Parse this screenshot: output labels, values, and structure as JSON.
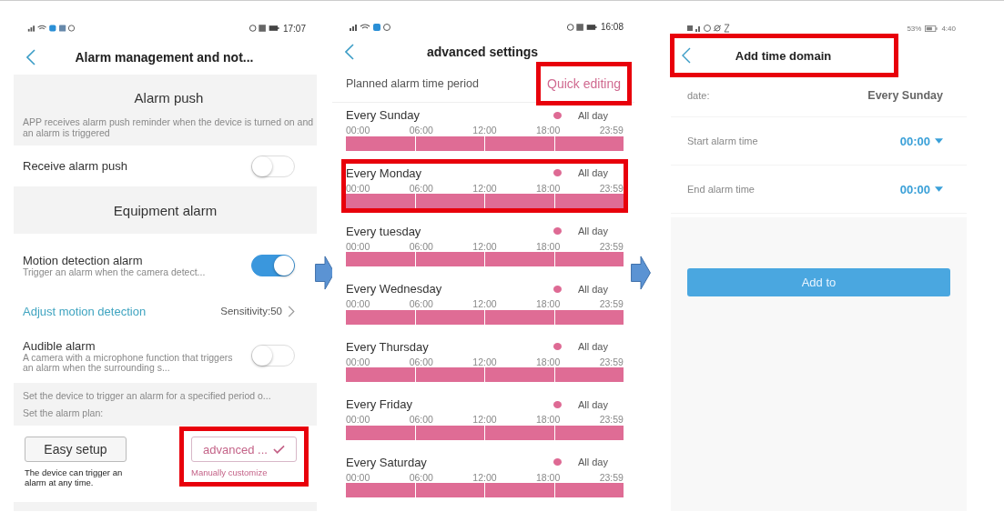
{
  "alarm_management": {
    "status_bar": {
      "time": "17:07"
    },
    "title": "Alarm management and not...",
    "push_section": {
      "heading": "Alarm push",
      "description": "APP receives alarm push reminder when the device is turned on and an alarm is triggered"
    },
    "receive_push": {
      "label": "Receive alarm push",
      "on": false
    },
    "equipment_heading": "Equipment alarm",
    "motion_alarm": {
      "label": "Motion detection alarm",
      "description": "Trigger an alarm when the camera detect...",
      "on": true
    },
    "adjust_motion": {
      "label": "Adjust motion detection",
      "value": "Sensitivity:50"
    },
    "audible_alarm": {
      "label": "Audible alarm",
      "description": "A camera with a microphone function that triggers an alarm when the surrounding s...",
      "on": false
    },
    "plan_note": [
      "Set the device to trigger an alarm for a specified period o...",
      "Set the alarm plan:"
    ],
    "plan_options": [
      {
        "label": "Easy setup",
        "caption": "The device can trigger an alarm at any time.",
        "selected": false,
        "highlighted": false
      },
      {
        "label": "advanced ...",
        "caption": "Manually customize",
        "selected": true,
        "highlighted": true
      }
    ]
  },
  "advanced_settings": {
    "status_bar": {
      "time": "16:08"
    },
    "title": "advanced settings",
    "period_label": "Planned alarm time period",
    "quick_edit": {
      "label": "Quick editing",
      "highlighted": true
    },
    "days": [
      {
        "name": "Every Sunday",
        "status": "All day",
        "ticks": [
          "00:00",
          "06:00",
          "12:00",
          "18:00",
          "23:59"
        ],
        "highlighted": false
      },
      {
        "name": "Every Monday",
        "status": "All day",
        "ticks": [
          "00:00",
          "06:00",
          "12:00",
          "18:00",
          "23:59"
        ],
        "highlighted": true
      },
      {
        "name": "Every tuesday",
        "status": "All day",
        "ticks": [
          "00:00",
          "06:00",
          "12:00",
          "18:00",
          "23:59"
        ],
        "highlighted": false
      },
      {
        "name": "Every Wednesday",
        "status": "All day",
        "ticks": [
          "00:00",
          "06:00",
          "12:00",
          "18:00",
          "23:59"
        ],
        "highlighted": false
      },
      {
        "name": "Every Thursday",
        "status": "All day",
        "ticks": [
          "00:00",
          "06:00",
          "12:00",
          "18:00",
          "23:59"
        ],
        "highlighted": false
      },
      {
        "name": "Every Friday",
        "status": "All day",
        "ticks": [
          "00:00",
          "06:00",
          "12:00",
          "18:00",
          "23:59"
        ],
        "highlighted": false
      },
      {
        "name": "Every Saturday",
        "status": "All day",
        "ticks": [
          "00:00",
          "06:00",
          "12:00",
          "18:00",
          "23:59"
        ],
        "highlighted": false
      }
    ]
  },
  "add_time_domain": {
    "status_bar": {
      "battery": "53%",
      "time": "4:40"
    },
    "title": "Add time domain",
    "highlighted": true,
    "fields": [
      {
        "kind": "text",
        "label": "date:",
        "value": "Every Sunday"
      },
      {
        "kind": "picker",
        "label": "Start alarm time",
        "value": "00:00"
      },
      {
        "kind": "picker",
        "label": "End alarm time",
        "value": "00:00"
      }
    ],
    "button": "Add to"
  }
}
